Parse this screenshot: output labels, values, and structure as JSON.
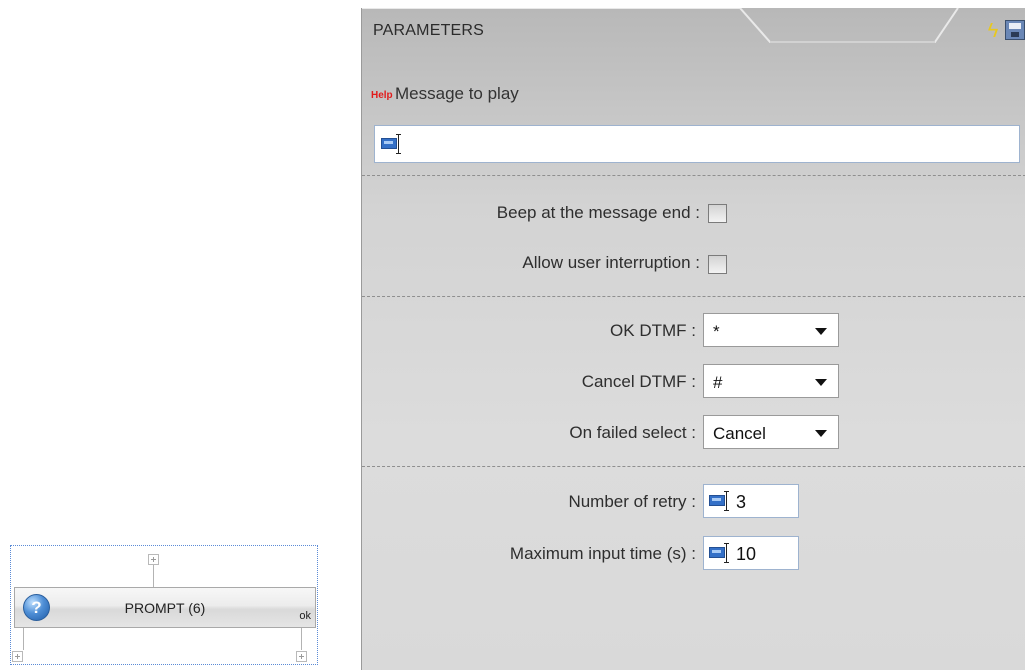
{
  "flow_block": {
    "prompt_label": "PROMPT (6)",
    "ok_label": "ok",
    "help_icon_glyph": "?"
  },
  "panel": {
    "title": "PARAMETERS",
    "bolt_glyph": "ϟ",
    "help_link": "Help",
    "message_label": "Message to play",
    "message_value": "",
    "beep_label": "Beep at the message end :",
    "beep_checked": false,
    "interrupt_label": "Allow user interruption :",
    "interrupt_checked": false,
    "ok_dtmf_label": "OK DTMF :",
    "ok_dtmf_value": "*",
    "cancel_dtmf_label": "Cancel DTMF :",
    "cancel_dtmf_value": "#",
    "failed_select_label": "On failed select :",
    "failed_select_value": "Cancel",
    "retry_label": "Number of retry :",
    "retry_value": "3",
    "max_input_label": "Maximum input time (s) :",
    "max_input_value": "10"
  },
  "colors": {
    "help_link": "#e11b1b",
    "selection_dotted": "#5b8bd6",
    "panel_bg": "#d6d6d6"
  }
}
